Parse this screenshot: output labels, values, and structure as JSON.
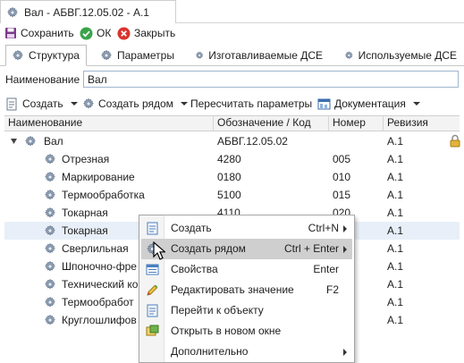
{
  "document_tab": {
    "title": "Вал - АБВГ.12.05.02 - А.1"
  },
  "toolbar": {
    "save_label": "Сохранить",
    "ok_label": "ОК",
    "close_label": "Закрыть"
  },
  "tabs": [
    {
      "label": "Структура",
      "active": true
    },
    {
      "label": "Параметры",
      "active": false
    },
    {
      "label": "Изготавливаемые ДСЕ",
      "active": false
    },
    {
      "label": "Используемые ДСЕ",
      "active": false
    }
  ],
  "name_field": {
    "label": "Наименование",
    "value": "Вал"
  },
  "grid_toolbar": {
    "create_label": "Создать",
    "create_nearby_label": "Создать рядом",
    "recalc_label": "Пересчитать параметры",
    "docs_label": "Документация"
  },
  "grid": {
    "columns": [
      "Наименование",
      "Обозначение / Код",
      "Номер",
      "Ревизия"
    ],
    "root": {
      "name": "Вал",
      "code": "АБВГ.12.05.02",
      "number": "",
      "revision": "А.1"
    },
    "rows": [
      {
        "name": "Отрезная",
        "code": "4280",
        "number": "005",
        "revision": "А.1"
      },
      {
        "name": "Маркирование",
        "code": "0180",
        "number": "010",
        "revision": "А.1"
      },
      {
        "name": "Термообработка",
        "code": "5100",
        "number": "015",
        "revision": "А.1"
      },
      {
        "name": "Токарная",
        "code": "4110",
        "number": "020",
        "revision": "А.1"
      },
      {
        "name": "Токарная",
        "code": "",
        "number": "",
        "revision": "А.1"
      },
      {
        "name": "Сверлильная",
        "code": "",
        "number": "",
        "revision": "А.1"
      },
      {
        "name": "Шпоночно-фре",
        "code": "",
        "number": "",
        "revision": "А.1"
      },
      {
        "name": "Технический ко",
        "code": "",
        "number": "",
        "revision": "А.1"
      },
      {
        "name": "Термообработ",
        "code": "",
        "number": "",
        "revision": "А.1"
      },
      {
        "name": "Круглошлифов",
        "code": "",
        "number": "",
        "revision": "А.1"
      }
    ]
  },
  "context_menu": {
    "items": [
      {
        "label": "Создать",
        "shortcut": "Ctrl+N",
        "submenu": true,
        "icon": "create-doc-icon"
      },
      {
        "label": "Создать рядом",
        "shortcut": "Ctrl + Enter",
        "submenu": true,
        "icon": "gear-icon",
        "highlighted": true
      },
      {
        "label": "Свойства",
        "shortcut": "Enter",
        "submenu": false,
        "icon": "properties-icon"
      },
      {
        "label": "Редактировать значение",
        "shortcut": "F2",
        "submenu": false,
        "icon": "pencil-icon"
      },
      {
        "label": "Перейти к объекту",
        "shortcut": "",
        "submenu": false,
        "icon": "goto-icon"
      },
      {
        "label": "Открыть в новом окне",
        "shortcut": "",
        "submenu": false,
        "icon": "new-window-icon"
      },
      {
        "label": "Дополнительно",
        "shortcut": "",
        "submenu": true,
        "icon": ""
      }
    ]
  },
  "colors": {
    "accent": "#2f6fc6",
    "selection": "#e8eff8",
    "menu_highlight": "#cfcfcf"
  }
}
